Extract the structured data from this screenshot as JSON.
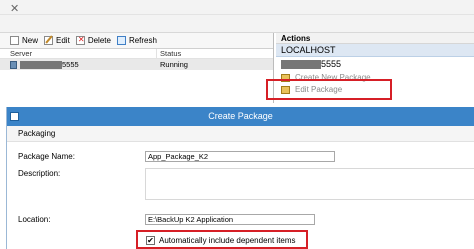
{
  "toolbar": {
    "new_label": "New",
    "edit_label": "Edit",
    "delete_label": "Delete",
    "refresh_label": "Refresh"
  },
  "grid": {
    "columns": [
      "Server",
      "Status"
    ],
    "rows": [
      {
        "server_suffix": "5555",
        "status": "Running"
      }
    ]
  },
  "actions": {
    "title": "Actions",
    "host": "LOCALHOST",
    "server_suffix": "5555",
    "items": [
      "Create New Package",
      "Edit Package"
    ]
  },
  "dialog": {
    "title": "Create Package",
    "section": "Packaging",
    "package_name_label": "Package Name:",
    "package_name_value": "App_Package_K2",
    "description_label": "Description:",
    "location_label": "Location:",
    "location_value": "E:\\BackUp K2 Application",
    "auto_include_label": "Automatically include dependent items",
    "auto_include_checked": true
  },
  "colors": {
    "highlight": "#d61f26",
    "dialog_titlebar": "#3b84c8",
    "actions_host_bg": "#dde7f3"
  }
}
